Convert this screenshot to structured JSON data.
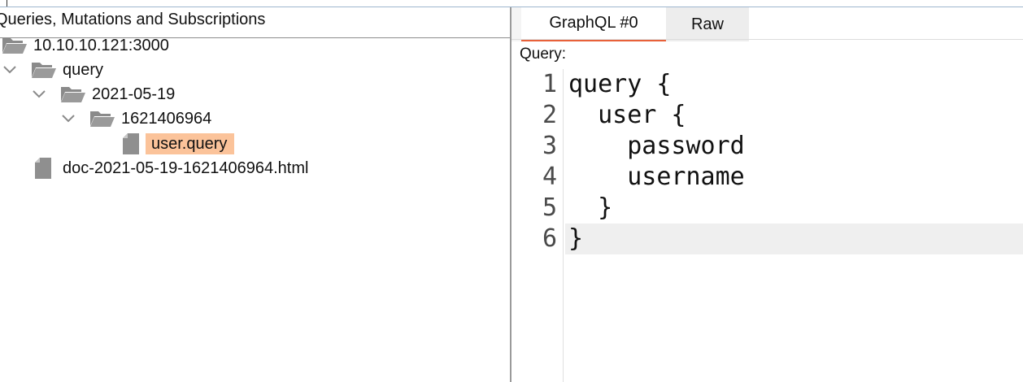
{
  "left_panel": {
    "title": "Queries, Mutations and Subscriptions",
    "tree": [
      {
        "label": "10.10.10.121:3000",
        "kind": "folder",
        "expanded": true
      },
      {
        "label": "query",
        "kind": "folder",
        "expanded": true
      },
      {
        "label": "2021-05-19",
        "kind": "folder",
        "expanded": true
      },
      {
        "label": "1621406964",
        "kind": "folder",
        "expanded": true
      },
      {
        "label": "user.query",
        "kind": "file",
        "selected": true
      },
      {
        "label": "doc-2021-05-19-1621406964.html",
        "kind": "file"
      }
    ]
  },
  "right_panel": {
    "tabs": [
      {
        "label": "GraphQL #0",
        "active": true
      },
      {
        "label": "Raw",
        "active": false
      }
    ],
    "query_label": "Query:",
    "code_lines": [
      {
        "num": "1",
        "text": "query {"
      },
      {
        "num": "2",
        "text": "  user {"
      },
      {
        "num": "3",
        "text": "    password"
      },
      {
        "num": "4",
        "text": "    username"
      },
      {
        "num": "5",
        "text": "  }"
      },
      {
        "num": "6",
        "text": "}"
      }
    ]
  },
  "colors": {
    "selection": "#fbc39a",
    "active_tab_underline": "#e8613a",
    "current_line": "#efefef",
    "folder_icon": "#8a8a8a"
  }
}
